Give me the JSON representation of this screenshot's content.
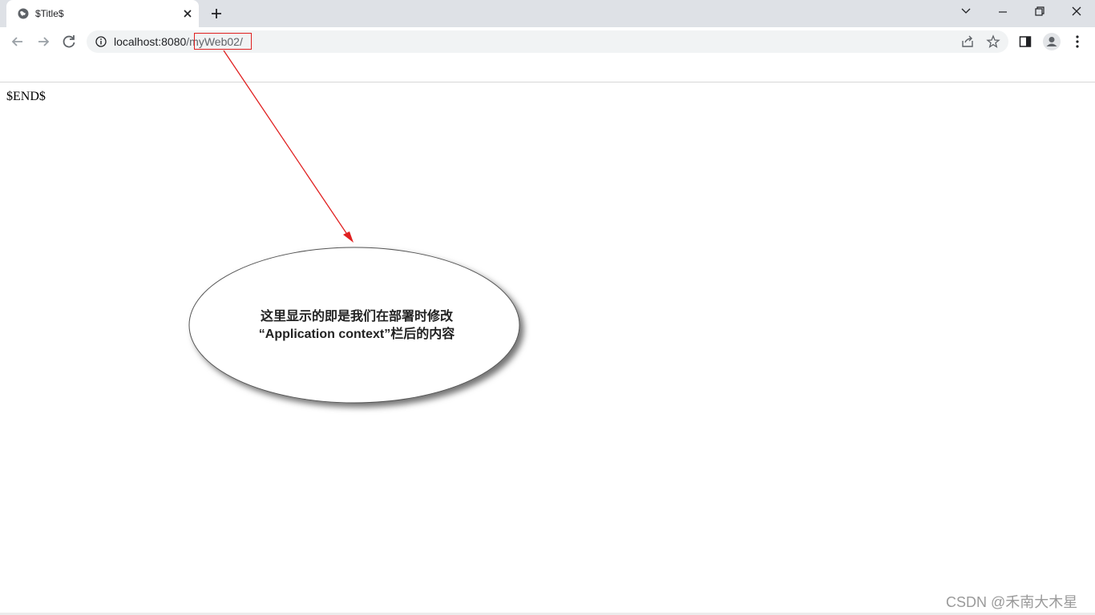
{
  "browser": {
    "tab_title": "$Title$",
    "url_host": "localhost:8080",
    "url_path": "/myWeb02/"
  },
  "page": {
    "body_text": "$END$"
  },
  "annotation": {
    "line1": "这里显示的即是我们在部署时修改",
    "line2": "“Application context”栏后的内容",
    "arrow_color": "#e02020"
  },
  "watermark": "CSDN @禾南大木星"
}
